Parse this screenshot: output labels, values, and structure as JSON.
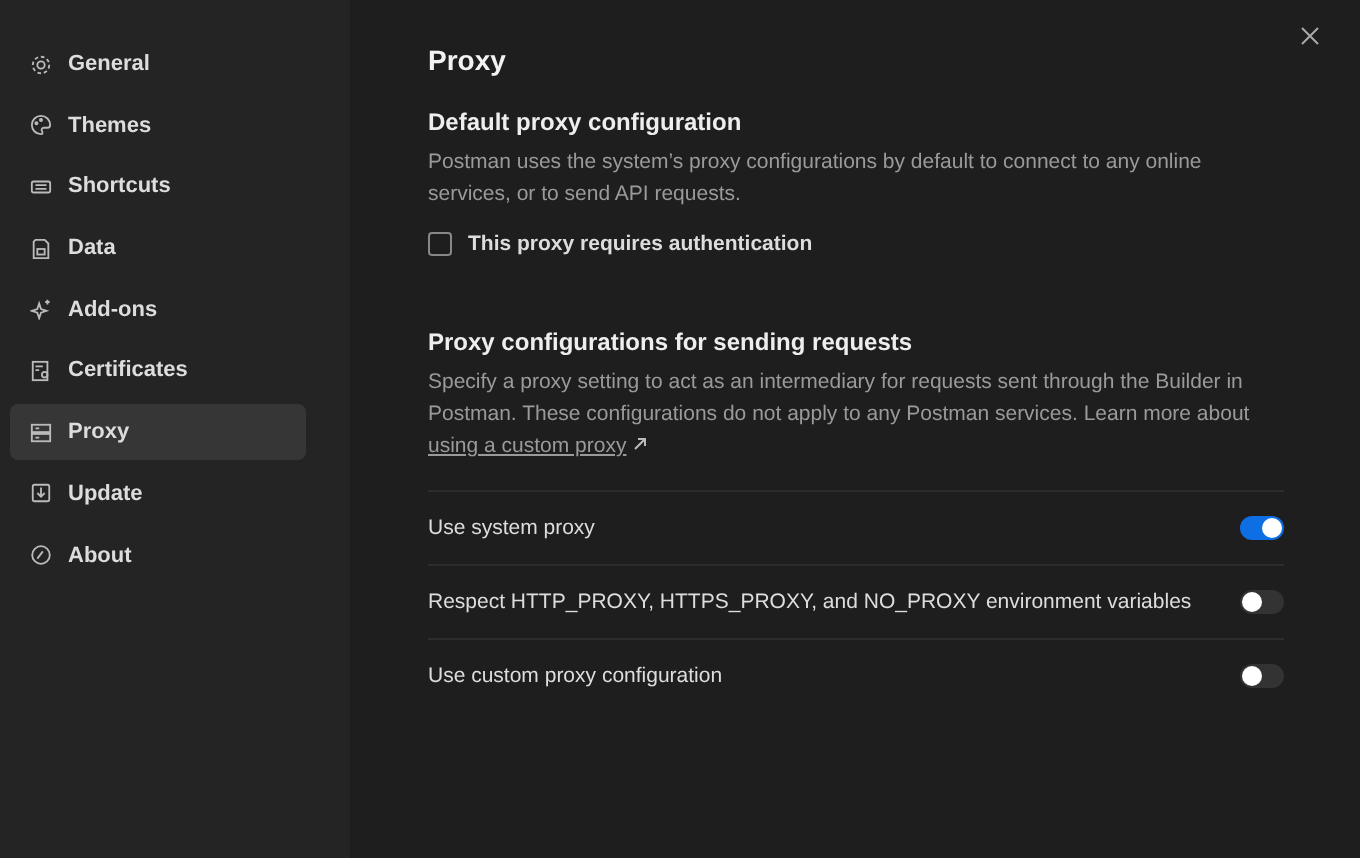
{
  "sidebar": {
    "items": [
      {
        "label": "General",
        "selected": false
      },
      {
        "label": "Themes",
        "selected": false
      },
      {
        "label": "Shortcuts",
        "selected": false
      },
      {
        "label": "Data",
        "selected": false
      },
      {
        "label": "Add-ons",
        "selected": false
      },
      {
        "label": "Certificates",
        "selected": false
      },
      {
        "label": "Proxy",
        "selected": true
      },
      {
        "label": "Update",
        "selected": false
      },
      {
        "label": "About",
        "selected": false
      }
    ]
  },
  "page": {
    "title": "Proxy",
    "default_section": {
      "heading": "Default proxy configuration",
      "description": "Postman uses the system’s proxy configurations by default to connect to any online services, or to send API requests.",
      "checkbox": {
        "label": "This proxy requires authentication",
        "checked": false
      }
    },
    "requests_section": {
      "heading": "Proxy configurations for sending requests",
      "description": "Specify a proxy setting to act as an intermediary for requests sent through the Builder in Postman. These configurations do not apply to any Postman services. Learn more about",
      "link": "using a custom proxy"
    },
    "toggles": [
      {
        "label": "Use system proxy",
        "on": true
      },
      {
        "label": "Respect HTTP_PROXY, HTTPS_PROXY, and NO_PROXY environment variables",
        "on": false
      },
      {
        "label": "Use custom proxy configuration",
        "on": false
      }
    ]
  }
}
